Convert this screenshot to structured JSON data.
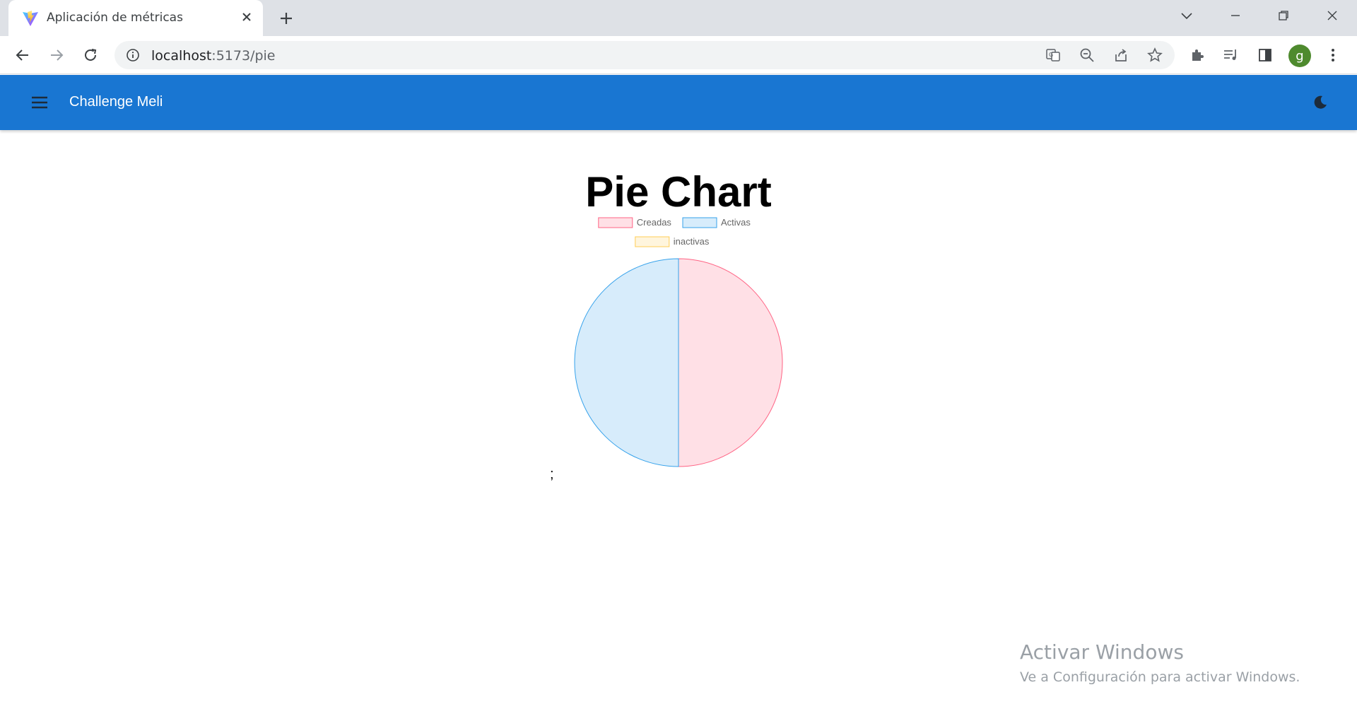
{
  "browser": {
    "tab_title": "Aplicación de métricas",
    "url_host": "localhost",
    "url_path": ":5173/pie",
    "profile_initial": "g"
  },
  "app": {
    "title": "Challenge Meli",
    "accent_color": "#1976d2"
  },
  "chart_data": {
    "type": "pie",
    "title": "Pie Chart",
    "legend_position": "top",
    "labels": [
      "Creadas",
      "Activas",
      "inactivas"
    ],
    "values": [
      1,
      1,
      0
    ],
    "fill_colors": [
      "#ffe0e6",
      "#d7ecfb",
      "#fff5dd"
    ],
    "border_colors": [
      "#ff6384",
      "#36a2eb",
      "#ffcd56"
    ]
  },
  "stray_text": ";",
  "watermark": {
    "line1": "Activar Windows",
    "line2": "Ve a Configuración para activar Windows."
  }
}
